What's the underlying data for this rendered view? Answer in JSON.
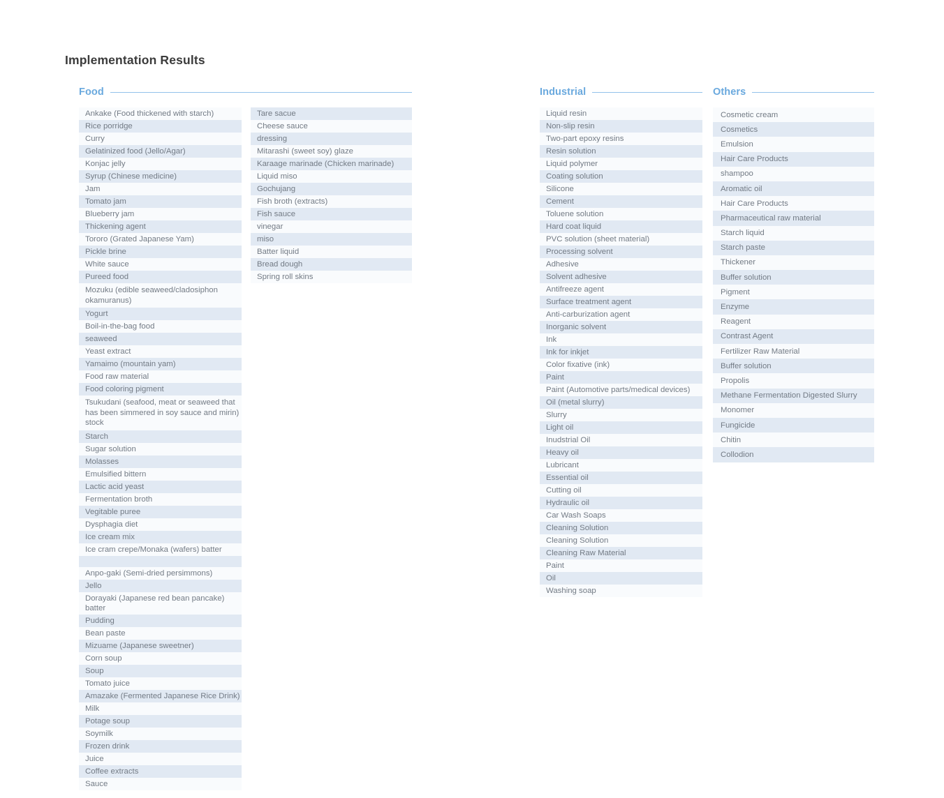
{
  "page": {
    "title": "Implementation Results",
    "background": "#ffffff",
    "accent_color": "#6aa9de",
    "rule_color": "#93c2ea",
    "row_alt_color": "#e1e9f3",
    "row_plain_color": "#f9fbfd",
    "text_color": "#737b85",
    "title_color": "#3b3b3b"
  },
  "sections": [
    {
      "id": "food",
      "title": "Food",
      "columns": [
        {
          "id": "food-col-1",
          "start_shaded": false,
          "items": [
            "Ankake (Food thickened with starch)",
            "Rice porridge",
            "Curry",
            "Gelatinized food (Jello/Agar)",
            "Konjac jelly",
            "Syrup (Chinese medicine)",
            "Jam",
            "Tomato jam",
            "Blueberry jam",
            "Thickening agent",
            "Tororo (Grated Japanese Yam)",
            "Pickle brine",
            "White sauce",
            "Pureed food",
            "Mozuku (edible seaweed/cladosiphon okamuranus)",
            "Yogurt",
            "Boil-in-the-bag food",
            "seaweed",
            "Yeast extract",
            "Yamaimo (mountain yam)",
            "Food raw material",
            "Food coloring pigment",
            "Tsukudani (seafood, meat or seaweed that has been simmered in soy sauce and mirin) stock",
            "Starch",
            "Sugar solution",
            "Molasses",
            "Emulsified bittern",
            "Lactic acid yeast",
            "Fermentation broth",
            "Vegitable puree",
            "Dysphagia diet",
            "Ice cream mix",
            "Ice cram crepe/Monaka (wafers) batter",
            "",
            "Anpo-gaki (Semi-dried persimmons)",
            "Jello",
            "Dorayaki (Japanese red bean pancake) batter",
            "Pudding",
            "Bean paste",
            "Mizuame (Japanese sweetner)",
            "Corn soup",
            "Soup",
            "Tomato juice",
            "Amazake (Fermented Japanese Rice Drink)",
            "Milk",
            "Potage soup",
            "Soymilk",
            "Frozen drink",
            "Juice",
            "Coffee extracts",
            "Sauce"
          ]
        },
        {
          "id": "food-col-2",
          "start_shaded": true,
          "items": [
            "Tare sacue",
            "Cheese sauce",
            "dressing",
            "Mitarashi (sweet soy) glaze",
            "Karaage marinade (Chicken marinade)",
            "Liquid miso",
            "Gochujang",
            "Fish broth (extracts)",
            "Fish sauce",
            "vinegar",
            "miso",
            "Batter liquid",
            "Bread dough",
            "Spring roll skins"
          ]
        }
      ]
    },
    {
      "id": "industrial",
      "title": "Industrial",
      "columns": [
        {
          "id": "industrial-col-1",
          "start_shaded": false,
          "items": [
            "Liquid resin",
            "Non-slip resin",
            "Two-part epoxy resins",
            "Resin solution",
            "Liquid polymer",
            "Coating solution",
            "Silicone",
            "Cement",
            "Toluene solution",
            "Hard coat liquid",
            "PVC solution (sheet material)",
            "Processing solvent",
            "Adhesive",
            "Solvent adhesive",
            "Antifreeze agent",
            "Surface treatment agent",
            "Anti-carburization agent",
            "Inorganic solvent",
            "Ink",
            "Ink for inkjet",
            "Color fixative (ink)",
            "Paint",
            "Paint (Automotive parts/medical devices)",
            "Oil (metal slurry)",
            "Slurry",
            "Light oil",
            "Inudstrial Oil",
            "Heavy oil",
            "Lubricant",
            "Essential oil",
            "Cutting oil",
            "Hydraulic oil",
            "Car Wash Soaps",
            "Cleaning Solution",
            "Cleaning Solution",
            "Cleaning Raw Material",
            "Paint",
            "Oil",
            "Washing soap"
          ]
        }
      ]
    },
    {
      "id": "others",
      "title": "Others",
      "columns": [
        {
          "id": "others-col-1",
          "start_shaded": false,
          "items": [
            "Cosmetic cream",
            "Cosmetics",
            "Emulsion",
            "Hair Care Products",
            "shampoo",
            "Aromatic oil",
            "Hair Care Products",
            "Pharmaceutical raw material",
            "Starch liquid",
            "Starch paste",
            "Thickener",
            "Buffer solution",
            "Pigment",
            "Enzyme",
            "Reagent",
            "Contrast Agent",
            "Fertilizer Raw Material",
            "Buffer solution",
            "Propolis",
            "Methane Fermentation Digested Slurry",
            "Monomer",
            "Fungicide",
            "Chitin",
            "Collodion"
          ]
        }
      ]
    }
  ]
}
